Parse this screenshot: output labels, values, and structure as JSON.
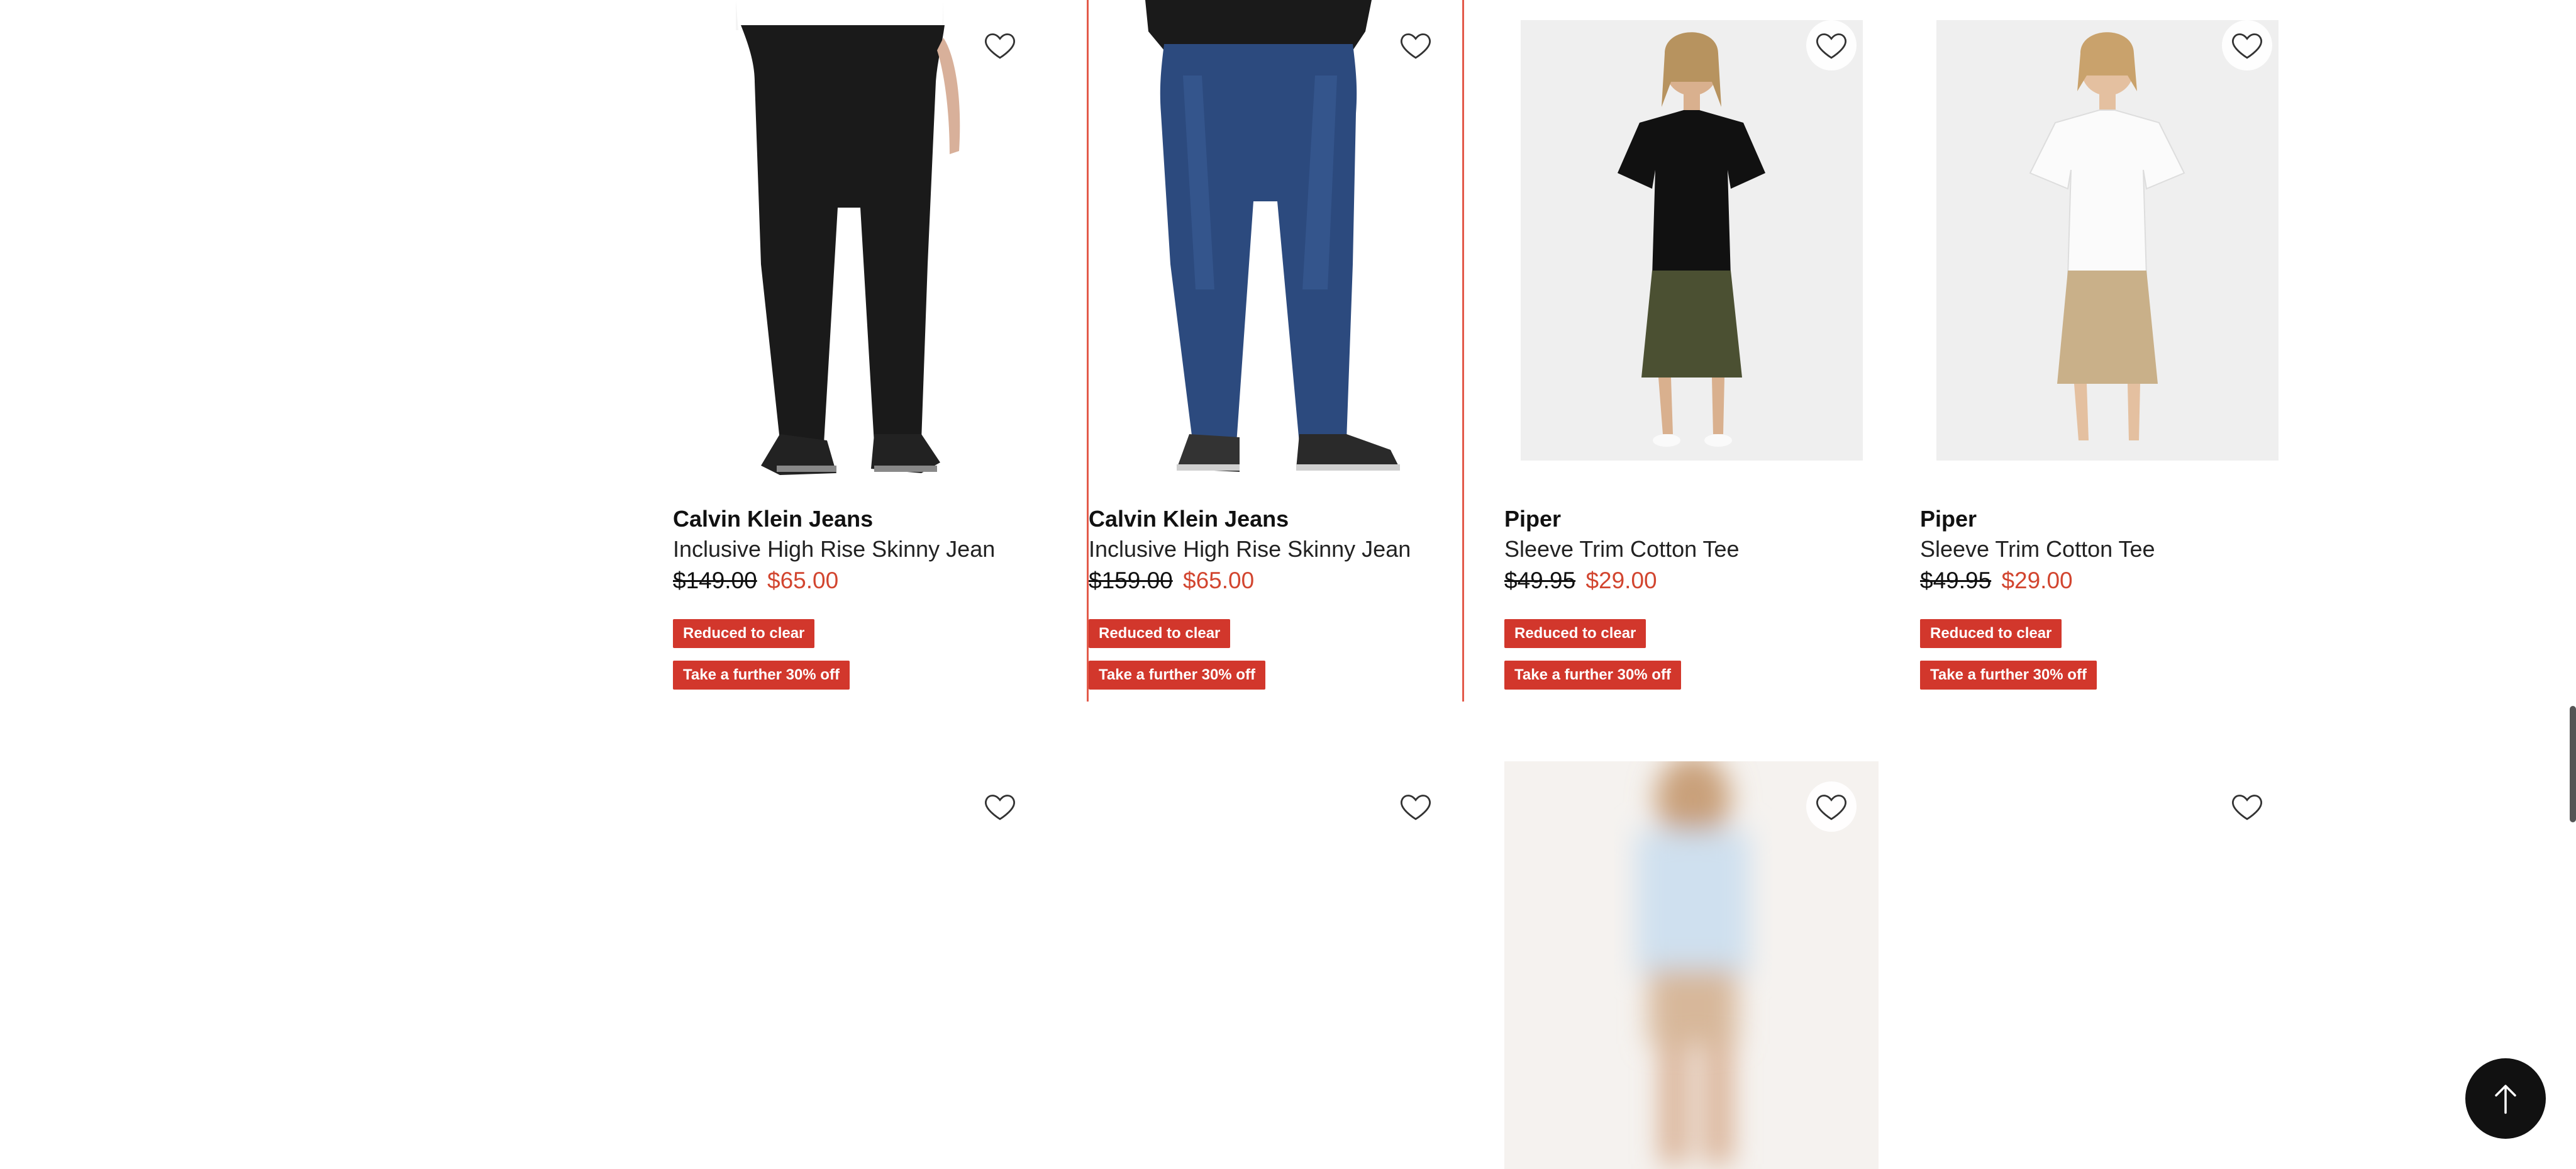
{
  "colors": {
    "sale": "#d2452f",
    "badge": "#d2372c",
    "highlight": "#e35a4a"
  },
  "products": [
    {
      "brand": "Calvin Klein Jeans",
      "name": "Inclusive High Rise Skinny Jean",
      "was": "$149.00",
      "now": "$65.00",
      "badge1": "Reduced to clear",
      "badge2": "Take a further 30% off"
    },
    {
      "brand": "Calvin Klein Jeans",
      "name": "Inclusive High Rise Skinny Jean",
      "was": "$159.00",
      "now": "$65.00",
      "badge1": "Reduced to clear",
      "badge2": "Take a further 30% off"
    },
    {
      "brand": "Piper",
      "name": "Sleeve Trim Cotton Tee",
      "was": "$49.95",
      "now": "$29.00",
      "badge1": "Reduced to clear",
      "badge2": "Take a further 30% off"
    },
    {
      "brand": "Piper",
      "name": "Sleeve Trim Cotton Tee",
      "was": "$49.95",
      "now": "$29.00",
      "badge1": "Reduced to clear",
      "badge2": "Take a further 30% off"
    }
  ],
  "icons": {
    "wishlist": "heart-outline-icon",
    "back_to_top": "arrow-up-icon"
  }
}
